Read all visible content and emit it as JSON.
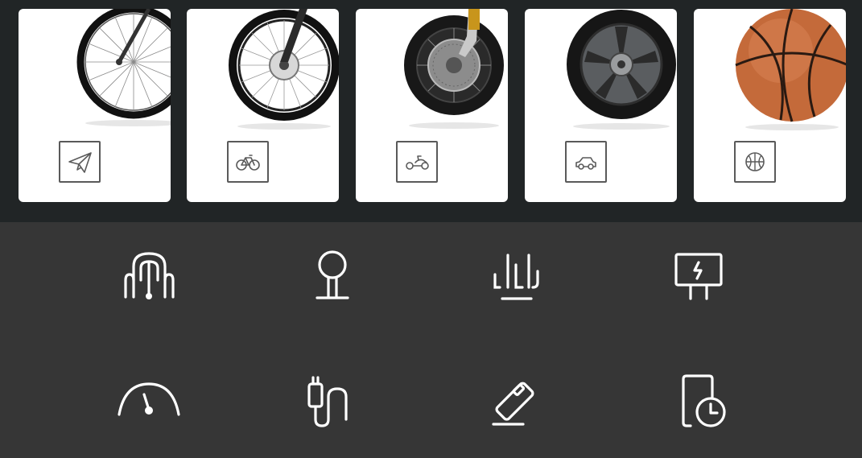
{
  "modes": [
    {
      "name": "send",
      "icon": "paper-plane-icon",
      "image": "bicycle-front-wheel"
    },
    {
      "name": "bicycle",
      "icon": "bicycle-icon",
      "image": "bicycle-disc-wheel"
    },
    {
      "name": "motorcycle",
      "icon": "scooter-icon",
      "image": "motorcycle-wheel"
    },
    {
      "name": "car",
      "icon": "car-icon",
      "image": "car-alloy-wheel"
    },
    {
      "name": "ball",
      "icon": "basketball-icon",
      "image": "basketball"
    }
  ],
  "features": [
    {
      "icon": "hose-connector-icon"
    },
    {
      "icon": "pressure-valve-icon"
    },
    {
      "icon": "level-bars-icon"
    },
    {
      "icon": "charging-display-icon"
    },
    {
      "icon": "pressure-gauge-icon"
    },
    {
      "icon": "cable-plug-icon"
    },
    {
      "icon": "powerbank-icon"
    },
    {
      "icon": "phone-timer-icon"
    }
  ],
  "colors": {
    "top_band": "#212526",
    "bottom_panel": "#363636",
    "card": "#ffffff",
    "icon_stroke": "#ffffff",
    "mode_icon_stroke": "#5a5a5a"
  }
}
